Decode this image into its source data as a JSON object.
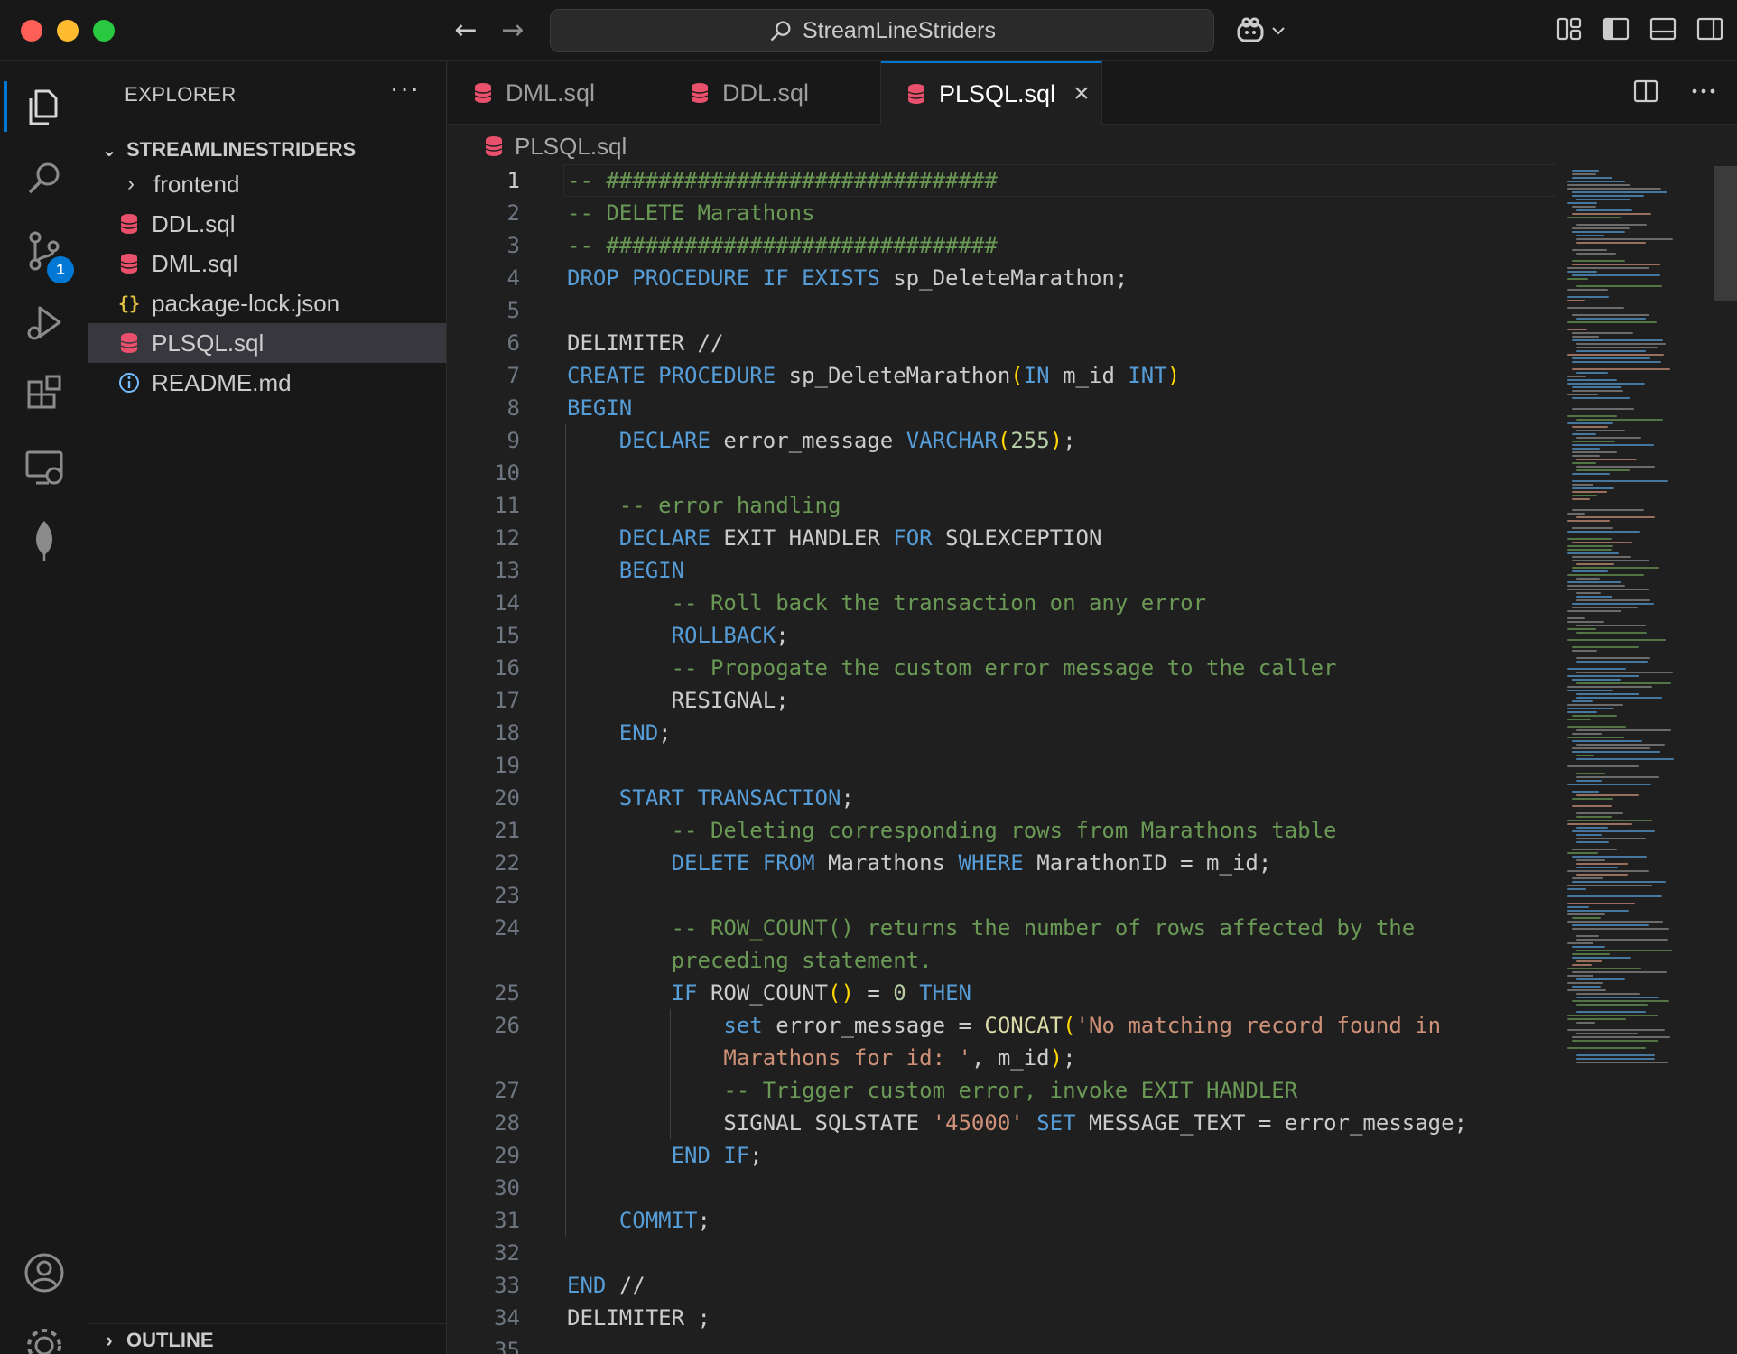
{
  "titlebar": {
    "search_text": "StreamLineStriders"
  },
  "sidebar": {
    "title": "EXPLORER",
    "more": "···",
    "section": "STREAMLINESTRIDERS",
    "items": [
      {
        "label": "frontend",
        "kind": "folder"
      },
      {
        "label": "DDL.sql",
        "kind": "sql"
      },
      {
        "label": "DML.sql",
        "kind": "sql"
      },
      {
        "label": "package-lock.json",
        "kind": "json"
      },
      {
        "label": "PLSQL.sql",
        "kind": "sql"
      },
      {
        "label": "README.md",
        "kind": "info"
      }
    ],
    "outline": "OUTLINE"
  },
  "activity": {
    "scm_badge": "1"
  },
  "tabs": [
    {
      "label": "DML.sql"
    },
    {
      "label": "DDL.sql"
    },
    {
      "label": "PLSQL.sql",
      "close": "×"
    }
  ],
  "breadcrumb": "PLSQL.sql",
  "code": {
    "line_numbers": [
      "1",
      "2",
      "3",
      "4",
      "5",
      "6",
      "7",
      "8",
      "9",
      "10",
      "11",
      "12",
      "13",
      "14",
      "15",
      "16",
      "17",
      "18",
      "19",
      "20",
      "21",
      "22",
      "23",
      "24",
      "",
      "25",
      "26",
      "",
      "27",
      "28",
      "29",
      "30",
      "31",
      "32",
      "33",
      "34",
      "35"
    ],
    "lines": [
      [
        {
          "t": "-- ##############################",
          "c": "c"
        }
      ],
      [
        {
          "t": "-- DELETE Marathons",
          "c": "c"
        }
      ],
      [
        {
          "t": "-- ##############################",
          "c": "c"
        }
      ],
      [
        {
          "t": "DROP PROCEDURE IF EXISTS",
          "c": "k"
        },
        {
          "t": " sp_DeleteMarathon;"
        }
      ],
      [],
      [
        {
          "t": "DELIMITER //"
        }
      ],
      [
        {
          "t": "CREATE PROCEDURE",
          "c": "k"
        },
        {
          "t": " sp_DeleteMarathon"
        },
        {
          "t": "(",
          "c": "p"
        },
        {
          "t": "IN",
          "c": "k"
        },
        {
          "t": " m_id "
        },
        {
          "t": "INT",
          "c": "k"
        },
        {
          "t": ")",
          "c": "p"
        }
      ],
      [
        {
          "t": "BEGIN",
          "c": "k"
        }
      ],
      [
        {
          "t": "    "
        },
        {
          "t": "DECLARE",
          "c": "k"
        },
        {
          "t": " error_message "
        },
        {
          "t": "VARCHAR",
          "c": "k"
        },
        {
          "t": "(",
          "c": "p"
        },
        {
          "t": "255",
          "c": "n"
        },
        {
          "t": ")",
          "c": "p"
        },
        {
          "t": ";"
        }
      ],
      [],
      [
        {
          "t": "    "
        },
        {
          "t": "-- error handling",
          "c": "c"
        }
      ],
      [
        {
          "t": "    "
        },
        {
          "t": "DECLARE",
          "c": "k"
        },
        {
          "t": " EXIT HANDLER "
        },
        {
          "t": "FOR",
          "c": "k"
        },
        {
          "t": " SQLEXCEPTION"
        }
      ],
      [
        {
          "t": "    "
        },
        {
          "t": "BEGIN",
          "c": "k"
        }
      ],
      [
        {
          "t": "        "
        },
        {
          "t": "-- Roll back the transaction on any error",
          "c": "c"
        }
      ],
      [
        {
          "t": "        "
        },
        {
          "t": "ROLLBACK",
          "c": "k"
        },
        {
          "t": ";"
        }
      ],
      [
        {
          "t": "        "
        },
        {
          "t": "-- Propogate the custom error message to the caller",
          "c": "c"
        }
      ],
      [
        {
          "t": "        RESIGNAL;"
        }
      ],
      [
        {
          "t": "    "
        },
        {
          "t": "END",
          "c": "k"
        },
        {
          "t": ";"
        }
      ],
      [],
      [
        {
          "t": "    "
        },
        {
          "t": "START TRANSACTION",
          "c": "k"
        },
        {
          "t": ";"
        }
      ],
      [
        {
          "t": "        "
        },
        {
          "t": "-- Deleting corresponding rows from Marathons table",
          "c": "c"
        }
      ],
      [
        {
          "t": "        "
        },
        {
          "t": "DELETE FROM",
          "c": "k"
        },
        {
          "t": " Marathons "
        },
        {
          "t": "WHERE",
          "c": "k"
        },
        {
          "t": " MarathonID = m_id;"
        }
      ],
      [],
      [
        {
          "t": "        "
        },
        {
          "t": "-- ROW_COUNT() returns the number of rows affected by the",
          "c": "c"
        }
      ],
      [
        {
          "t": "        "
        },
        {
          "t": "preceding statement.",
          "c": "c"
        }
      ],
      [
        {
          "t": "        "
        },
        {
          "t": "IF",
          "c": "k"
        },
        {
          "t": " ROW_COUNT"
        },
        {
          "t": "()",
          "c": "p"
        },
        {
          "t": " = "
        },
        {
          "t": "0",
          "c": "n"
        },
        {
          "t": " "
        },
        {
          "t": "THEN",
          "c": "k"
        }
      ],
      [
        {
          "t": "            "
        },
        {
          "t": "set",
          "c": "k"
        },
        {
          "t": " error_message = "
        },
        {
          "t": "CONCAT",
          "c": "f"
        },
        {
          "t": "(",
          "c": "p"
        },
        {
          "t": "'No matching record found in",
          "c": "s"
        }
      ],
      [
        {
          "t": "            "
        },
        {
          "t": "Marathons for id: '",
          "c": "s"
        },
        {
          "t": ", m_id"
        },
        {
          "t": ")",
          "c": "p"
        },
        {
          "t": ";"
        }
      ],
      [
        {
          "t": "            "
        },
        {
          "t": "-- Trigger custom error, invoke EXIT HANDLER",
          "c": "c"
        }
      ],
      [
        {
          "t": "            SIGNAL SQLSTATE "
        },
        {
          "t": "'45000'",
          "c": "s"
        },
        {
          "t": " "
        },
        {
          "t": "SET",
          "c": "k"
        },
        {
          "t": " MESSAGE_TEXT = error_message;"
        }
      ],
      [
        {
          "t": "        "
        },
        {
          "t": "END IF",
          "c": "k"
        },
        {
          "t": ";"
        }
      ],
      [],
      [
        {
          "t": "    "
        },
        {
          "t": "COMMIT",
          "c": "k"
        },
        {
          "t": ";"
        }
      ],
      [],
      [
        {
          "t": "END",
          "c": "k"
        },
        {
          "t": " //"
        }
      ],
      [
        {
          "t": "DELIMITER ;"
        }
      ],
      []
    ]
  },
  "colors": {
    "accent": "#0078d4",
    "sql_icon": "#e8506b",
    "json_icon": "#e2c044",
    "info_icon": "#75beff"
  }
}
